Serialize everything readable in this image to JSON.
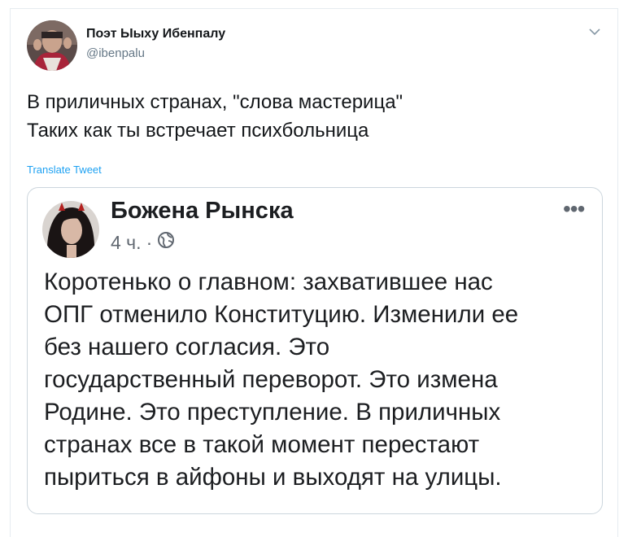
{
  "tweet": {
    "author_name": "Поэт Ыыху Ибенпалу",
    "author_handle": "@ibenpalu",
    "text_lines": [
      "В приличных странах, \"слова мастерица\"",
      "Таких как ты встречает психбольница"
    ],
    "translate_label": "Translate Tweet"
  },
  "embedded_post": {
    "author_name": "Божена Рынска",
    "time": "4 ч.",
    "separator": "·",
    "more_label": "•••",
    "text_lines": [
      "Коротенько о главном: захватившее нас",
      "ОПГ отменило Конституцию. Изменили ее",
      "без нашего согласия. Это",
      "государственный переворот. Это измена",
      "Родине. Это преступление. В приличных",
      "странах все в такой момент перестают",
      "пыриться в айфоны и выходят на улицы."
    ]
  },
  "icons": {
    "caret": "chevron-down-icon",
    "globe": "globe-icon"
  },
  "colors": {
    "link": "#1da1f2",
    "secondary_text": "#657786",
    "border": "#ccd6dd"
  }
}
